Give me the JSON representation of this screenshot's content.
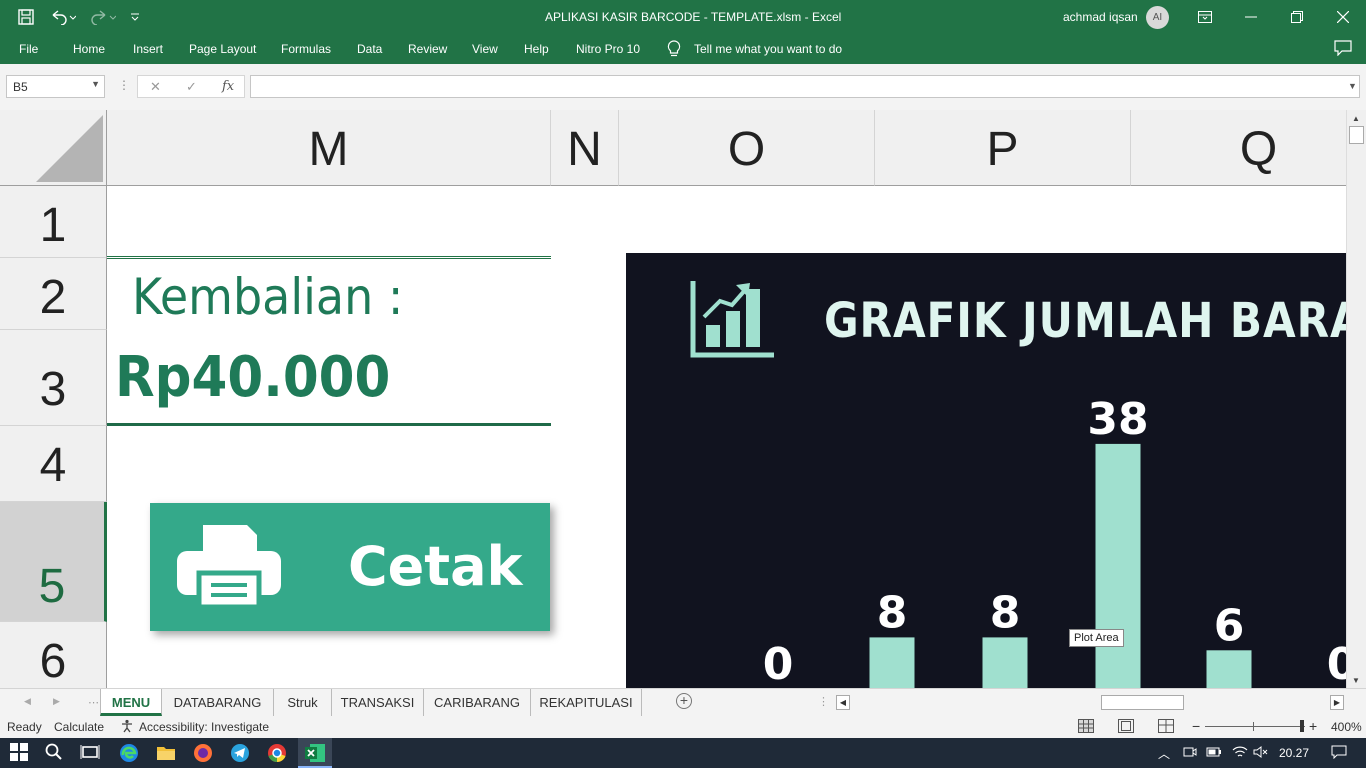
{
  "window": {
    "title": "APLIKASI KASIR BARCODE - TEMPLATE.xlsm  -  Excel",
    "user_name": "achmad iqsan",
    "avatar_initials": "AI"
  },
  "ribbon_tabs": [
    "File",
    "Home",
    "Insert",
    "Page Layout",
    "Formulas",
    "Data",
    "Review",
    "View",
    "Help",
    "Nitro Pro 10",
    "Tell me what you want to do"
  ],
  "formula_bar": {
    "name_box": "B5",
    "formula": ""
  },
  "columns": [
    "M",
    "N",
    "O",
    "P",
    "Q"
  ],
  "rows": [
    "1",
    "2",
    "3",
    "4",
    "5",
    "6"
  ],
  "cells": {
    "kembalian_label": "Kembalian :",
    "kembalian_value": "Rp40.000"
  },
  "cetak_button": {
    "label": "Cetak",
    "icon": "printer-icon"
  },
  "chart": {
    "title": "GRAFIK JUMLAH BARAN",
    "icon": "bar-chart-growth-icon",
    "tooltip": "Plot Area",
    "background": "#11131f",
    "bar_color": "#a0e0cf",
    "title_color": "#dff5ef"
  },
  "chart_data": {
    "type": "bar",
    "title": "GRAFIK JUMLAH BARAN",
    "categories": [
      "",
      "",
      "",
      "",
      "",
      ""
    ],
    "values": [
      0,
      8,
      8,
      38,
      6,
      0
    ],
    "data_labels": [
      "0",
      "8",
      "8",
      "38",
      "6",
      "0"
    ],
    "ylim": [
      0,
      40
    ],
    "grid": false
  },
  "sheet_tabs": [
    "MENU",
    "DATABARANG",
    "Struk",
    "TRANSAKSI",
    "CARIBARANG",
    "REKAPITULASI"
  ],
  "status_bar": {
    "ready": "Ready",
    "calculate": "Calculate",
    "accessibility": "Accessibility: Investigate",
    "zoom": "400%"
  },
  "taskbar": {
    "time": "20.27"
  },
  "colors": {
    "excel_green": "#217346",
    "accent_teal": "#34a98a",
    "text_green": "#217346"
  }
}
